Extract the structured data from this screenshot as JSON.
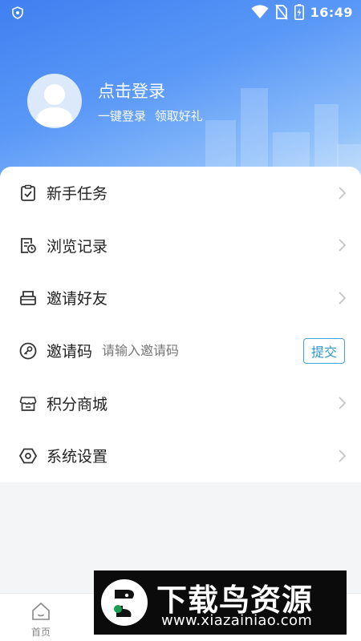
{
  "status_bar": {
    "time": "16:49"
  },
  "profile": {
    "login_title": "点击登录",
    "login_subtitle": "一键登录 领取好礼"
  },
  "menu": {
    "items": [
      {
        "label": "新手任务",
        "icon": "task-checklist-icon"
      },
      {
        "label": "浏览记录",
        "icon": "history-record-icon"
      },
      {
        "label": "邀请好友",
        "icon": "invite-envelope-icon"
      },
      {
        "label": "邀请码",
        "icon": "invite-code-key-icon",
        "placeholder": "请输入邀请码",
        "button": "提交"
      },
      {
        "label": "积分商城",
        "icon": "store-icon"
      },
      {
        "label": "系统设置",
        "icon": "settings-hexagon-icon"
      }
    ]
  },
  "bottom_nav": {
    "home_label": "首页"
  },
  "watermark": {
    "title": "下载鸟资源",
    "url": "www.xiazainiao.com"
  },
  "colors": {
    "header_start": "#3f7ff0",
    "header_end": "#c7e2fb",
    "submit_border": "#3ea6d6"
  }
}
